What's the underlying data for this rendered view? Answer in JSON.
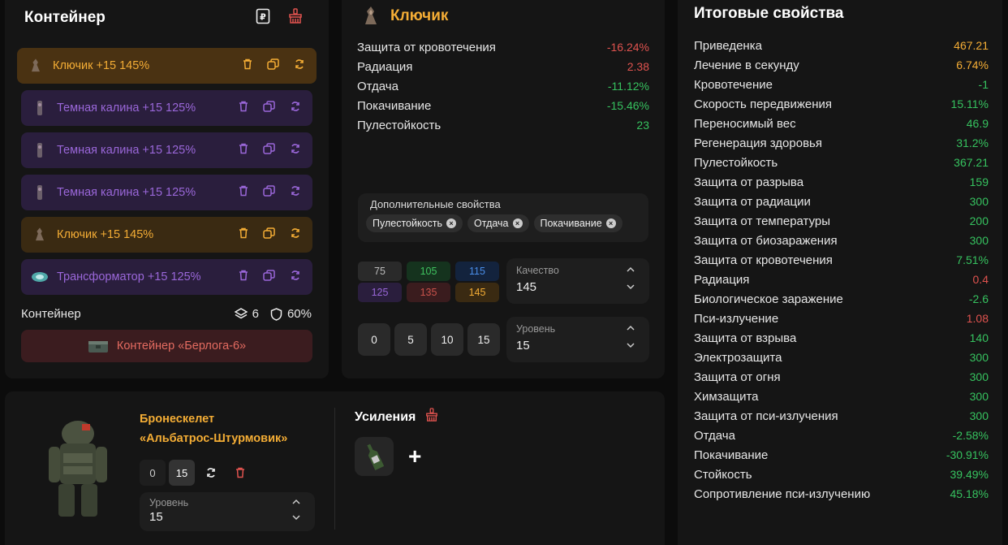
{
  "container": {
    "title": "Контейнер",
    "items": [
      {
        "name": "Ключик",
        "plus": "+15",
        "pct": "145%",
        "style": "gold"
      },
      {
        "name": "Темная калина",
        "plus": "+15",
        "pct": "125%",
        "style": "purple"
      },
      {
        "name": "Темная калина",
        "plus": "+15",
        "pct": "125%",
        "style": "purple"
      },
      {
        "name": "Темная калина",
        "plus": "+15",
        "pct": "125%",
        "style": "purple"
      },
      {
        "name": "Ключик",
        "plus": "+15",
        "pct": "145%",
        "style": "gold"
      },
      {
        "name": "Трансформатор",
        "plus": "+15",
        "pct": "125%",
        "style": "purple"
      }
    ],
    "footer_label": "Контейнер",
    "slots": "6",
    "protection": "60%",
    "container_name": "Контейнер «Берлога-6»"
  },
  "artifact": {
    "title": "Ключик",
    "props": [
      {
        "label": "Защита от кровотечения",
        "value": "-16.24%",
        "color": "neg"
      },
      {
        "label": "Радиация",
        "value": "2.38",
        "color": "neg"
      },
      {
        "label": "Отдача",
        "value": "-11.12%",
        "color": "pos"
      },
      {
        "label": "Покачивание",
        "value": "-15.46%",
        "color": "pos"
      },
      {
        "label": "Пулестойкость",
        "value": "23",
        "color": "pos"
      }
    ],
    "additional_title": "Дополнительные свойства",
    "chips": [
      "Пулестойкость",
      "Отдача",
      "Покачивание"
    ],
    "quality_buttons": [
      {
        "label": "75",
        "bg": "#2a2a2a",
        "fg": "#bbbbbb"
      },
      {
        "label": "105",
        "bg": "#15331e",
        "fg": "#3fc25f"
      },
      {
        "label": "115",
        "bg": "#13233d",
        "fg": "#4a8ee8"
      },
      {
        "label": "125",
        "bg": "#2a1e3d",
        "fg": "#9a67d9"
      },
      {
        "label": "135",
        "bg": "#3a1c1e",
        "fg": "#c9524b"
      },
      {
        "label": "145",
        "bg": "#3a2a12",
        "fg": "#f4ad35"
      }
    ],
    "quality_label": "Качество",
    "quality_value": "145",
    "level_buttons": [
      "0",
      "5",
      "10",
      "15"
    ],
    "level_label": "Уровень",
    "level_value": "15"
  },
  "armor": {
    "name_line1": "Бронескелет",
    "name_line2": "«Альбатрос-Штурмовик»",
    "btn_0": "0",
    "btn_15": "15",
    "level_label": "Уровень",
    "level_value": "15",
    "boosts_title": "Усиления",
    "add": "+"
  },
  "totals": {
    "title": "Итоговые свойства",
    "rows": [
      {
        "label": "Приведенка",
        "value": "467.21",
        "color": "gold-t"
      },
      {
        "label": "Лечение в секунду",
        "value": "6.74%",
        "color": "gold-t"
      },
      {
        "label": "Кровотечение",
        "value": "-1",
        "color": "pos"
      },
      {
        "label": "Скорость передвижения",
        "value": "15.11%",
        "color": "pos"
      },
      {
        "label": "Переносимый вес",
        "value": "46.9",
        "color": "pos"
      },
      {
        "label": "Регенерация здоровья",
        "value": "31.2%",
        "color": "pos"
      },
      {
        "label": "Пулестойкость",
        "value": "367.21",
        "color": "pos"
      },
      {
        "label": "Защита от разрыва",
        "value": "159",
        "color": "pos"
      },
      {
        "label": "Защита от радиации",
        "value": "300",
        "color": "pos"
      },
      {
        "label": "Защита от температуры",
        "value": "200",
        "color": "pos"
      },
      {
        "label": "Защита от биозаражения",
        "value": "300",
        "color": "pos"
      },
      {
        "label": "Защита от кровотечения",
        "value": "7.51%",
        "color": "pos"
      },
      {
        "label": "Радиация",
        "value": "0.4",
        "color": "neg"
      },
      {
        "label": "Биологическое заражение",
        "value": "-2.6",
        "color": "pos"
      },
      {
        "label": "Пси-излучение",
        "value": "1.08",
        "color": "neg"
      },
      {
        "label": "Защита от взрыва",
        "value": "140",
        "color": "pos"
      },
      {
        "label": "Электрозащита",
        "value": "300",
        "color": "pos"
      },
      {
        "label": "Защита от огня",
        "value": "300",
        "color": "pos"
      },
      {
        "label": "Химзащита",
        "value": "300",
        "color": "pos"
      },
      {
        "label": "Защита от пси-излучения",
        "value": "300",
        "color": "pos"
      },
      {
        "label": "Отдача",
        "value": "-2.58%",
        "color": "pos"
      },
      {
        "label": "Покачивание",
        "value": "-30.91%",
        "color": "pos"
      },
      {
        "label": "Стойкость",
        "value": "39.49%",
        "color": "pos"
      },
      {
        "label": "Сопротивление пси-излучению",
        "value": "45.18%",
        "color": "pos"
      }
    ]
  }
}
